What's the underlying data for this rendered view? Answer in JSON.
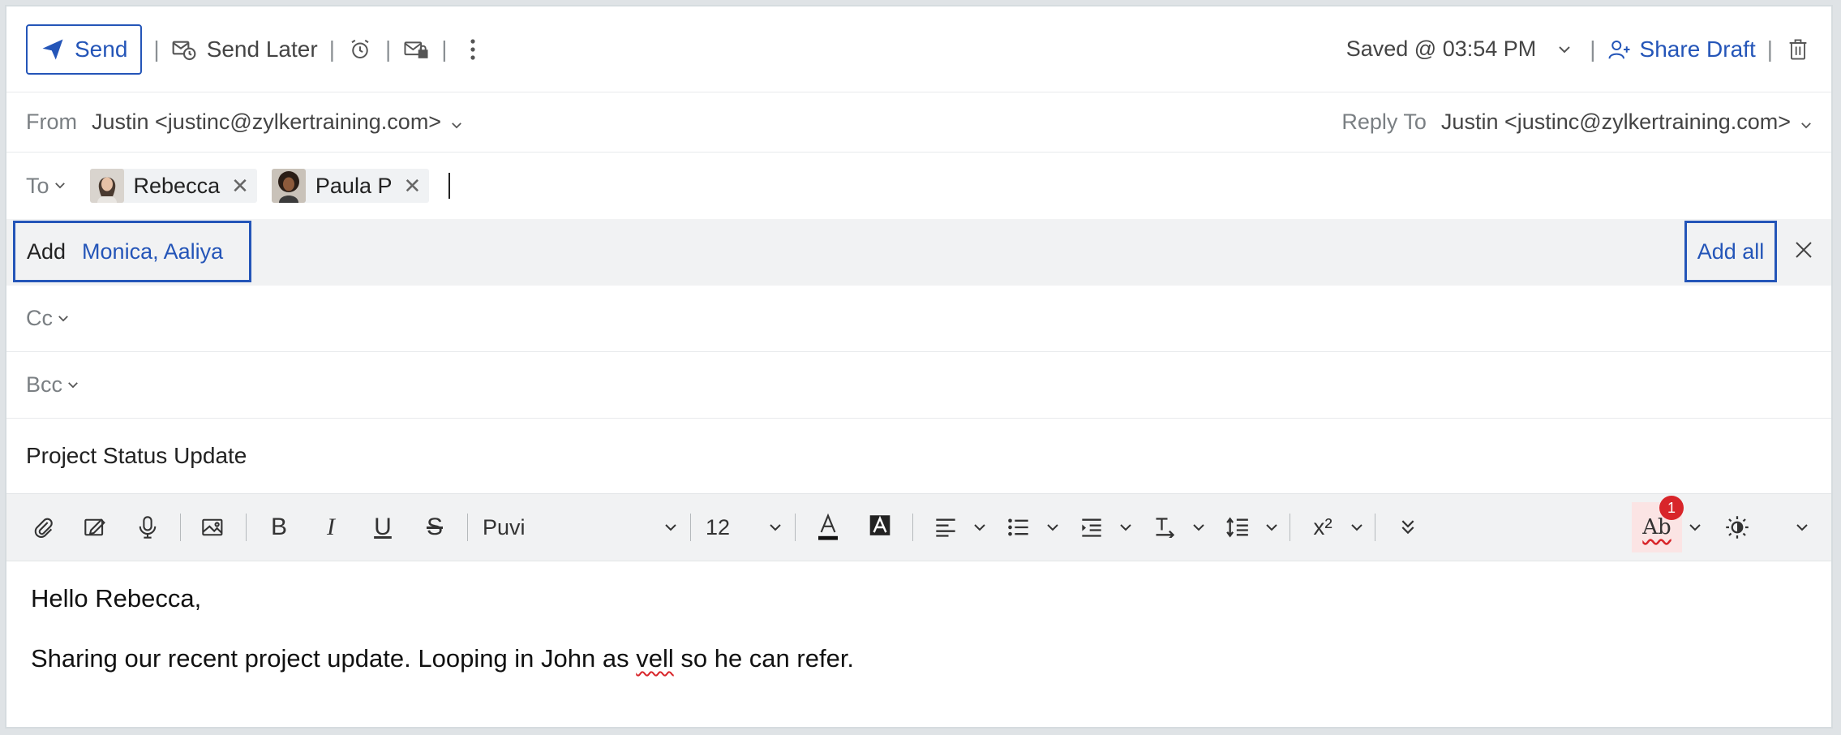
{
  "toolbar": {
    "send_label": "Send",
    "send_later_label": "Send Later",
    "saved_text": "Saved @ 03:54 PM",
    "share_draft_label": "Share Draft"
  },
  "header": {
    "from_label": "From",
    "from_value": "Justin <justinc@zylkertraining.com>",
    "reply_to_label": "Reply To",
    "reply_to_value": "Justin <justinc@zylkertraining.com>",
    "to_label": "To",
    "recipients": [
      {
        "name": "Rebecca"
      },
      {
        "name": "Paula P"
      }
    ],
    "cc_label": "Cc",
    "bcc_label": "Bcc"
  },
  "suggestion": {
    "add_label": "Add",
    "names": "Monica,  Aaliya",
    "add_all_label": "Add all"
  },
  "subject": "Project Status Update",
  "format": {
    "font_name": "Puvi",
    "font_size": "12",
    "spell_label": "Ab",
    "spell_badge": "1"
  },
  "body": {
    "greeting": "Hello Rebecca,",
    "line_before": "Sharing our recent project update. Looping in John as ",
    "misspelled_word": "vell",
    "line_after": " so he can refer."
  },
  "colors": {
    "accent": "#2455b8",
    "badge": "#d8252a"
  }
}
